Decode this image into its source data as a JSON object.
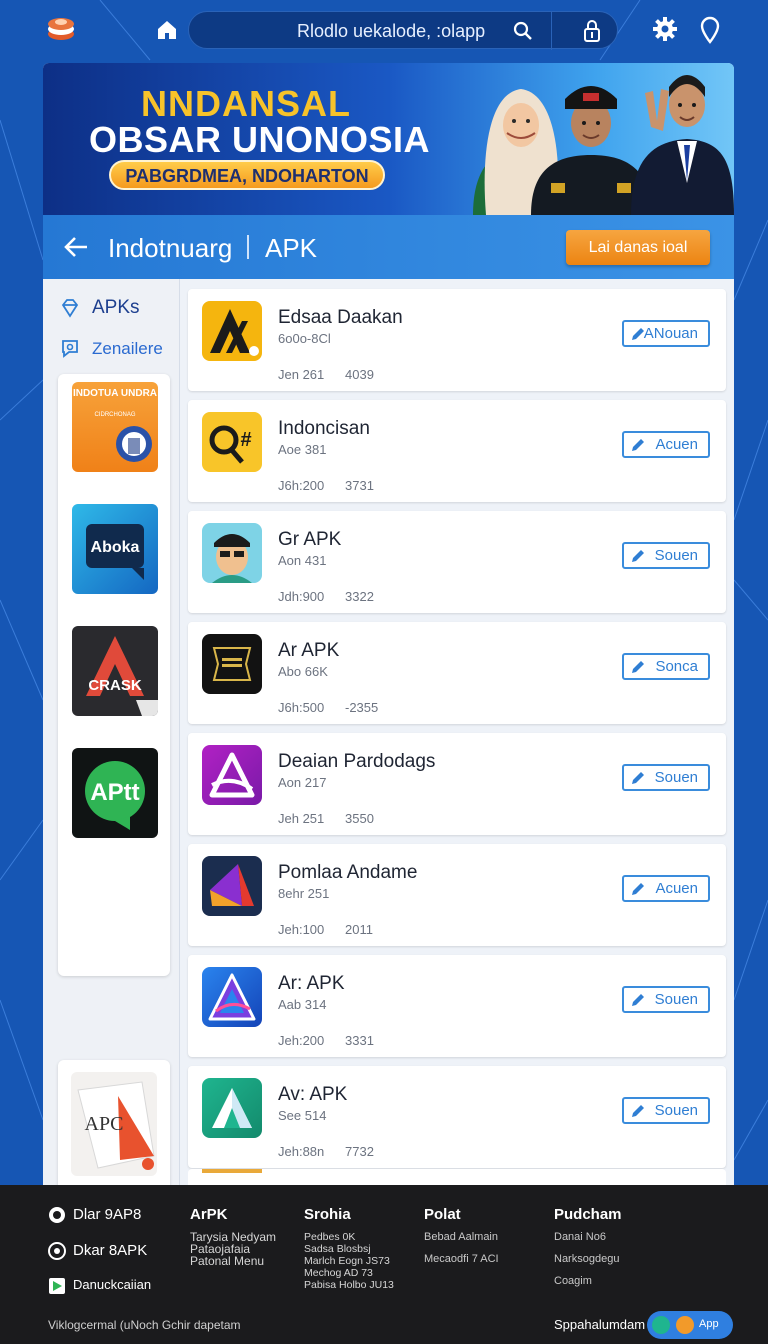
{
  "topbar": {
    "search_value": "Rlodlo uekalode, :olapp",
    "icons": [
      "logo-icon",
      "home-icon",
      "search-icon",
      "lock-icon",
      "gear-icon",
      "location-pin-icon"
    ]
  },
  "banner": {
    "line1": "NNDANSAL",
    "line2": "OBSAR UNONOSIA",
    "pill": "PABGRDMEA, NDOHARTON"
  },
  "titlebar": {
    "title": "Indotnuarg",
    "apk": "APK",
    "button": "Lai danas ioal"
  },
  "sidebar": {
    "items": [
      {
        "label": "APKs",
        "icon": "diamond-icon"
      },
      {
        "label": "Zenailere",
        "icon": "chat-icon"
      }
    ],
    "cards": [
      {
        "label": "INDOTUA UNDRA",
        "sub": "CIDRCHONAG"
      },
      {
        "label": "Aboka"
      },
      {
        "label": "CRASK"
      },
      {
        "label": "APtt"
      },
      {
        "label": "APC"
      }
    ]
  },
  "apps": [
    {
      "name": "Edsaa Daakan",
      "sub": "6o0o-8Cl",
      "meta1": "Jen 261",
      "meta2": "4039",
      "action": "ANouan"
    },
    {
      "name": "Indoncisan",
      "sub": "Aoe 381",
      "meta1": "J6h:200",
      "meta2": "3731",
      "action": "Acuen"
    },
    {
      "name": "Gr APK",
      "sub": "Aon 431",
      "meta1": "Jdh:900",
      "meta2": "3322",
      "action": "Souen"
    },
    {
      "name": "Ar APK",
      "sub": "Abo 66K",
      "meta1": "J6h:500",
      "meta2": "-2355",
      "action": "Sonca"
    },
    {
      "name": "Deaian Pardodags",
      "sub": "Aon 217",
      "meta1": "Jeh 251",
      "meta2": "3550",
      "action": "Souen"
    },
    {
      "name": "Pomlaa Andame",
      "sub": "8ehr 251",
      "meta1": "Jeh:100",
      "meta2": "2011",
      "action": "Acuen"
    },
    {
      "name": "Ar: APK",
      "sub": "Aab 314",
      "meta1": "Jeh:200",
      "meta2": "3331",
      "action": "Souen"
    },
    {
      "name": "Av: APK",
      "sub": "See 514",
      "meta1": "Jeh:88n",
      "meta2": "7732",
      "action": "Souen"
    }
  ],
  "footer": {
    "apps": [
      "Dlar 9AP8",
      "Dkar 8APK",
      "Danuckcaiian"
    ],
    "col1": {
      "head": "ArPK",
      "lines": [
        "Tarysia Nedyam",
        "Pataojafaia",
        "Patonal Menu"
      ]
    },
    "col2": {
      "head": "Srohia",
      "lines": [
        "Pedbes 0K",
        "Sadsa Blosbsj",
        "Marlch Eogn JS73",
        "Mechog AD 73",
        "Pabisa Holbo JU13"
      ]
    },
    "col3": {
      "head": "Polat",
      "lines": [
        "Bebad Aalmain",
        "Mecaodfi 7 ACI"
      ]
    },
    "col4": {
      "head": "Pudcham",
      "lines": [
        "Danai No6",
        "Narksogdegu",
        "Coagim"
      ]
    },
    "bottom": "Viklogcermal (uNoch Gchir dapetam",
    "brand": "Sppahalumdam",
    "pill": "App"
  },
  "colors": {
    "background": "#1656b4",
    "accent": "#2578d4",
    "button_orange": "#ec8412",
    "footer": "#1b1b1d"
  }
}
